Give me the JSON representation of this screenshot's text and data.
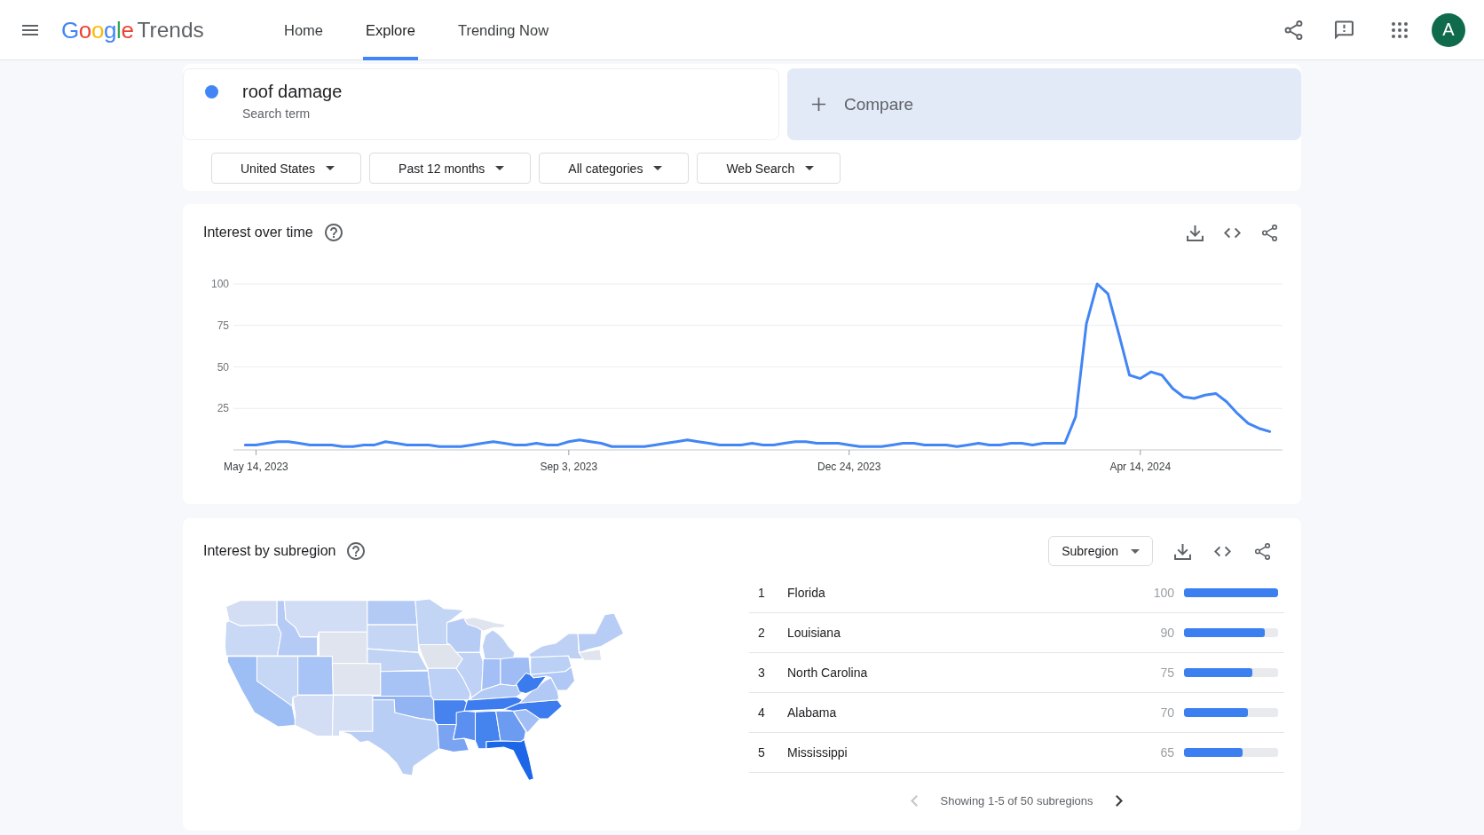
{
  "header": {
    "logo": {
      "brand": "Google",
      "product": "Trends"
    },
    "nav": [
      {
        "label": "Home",
        "selected": false
      },
      {
        "label": "Explore",
        "selected": true
      },
      {
        "label": "Trending Now",
        "selected": false
      }
    ],
    "avatar": "A"
  },
  "search": {
    "terms": [
      {
        "term": "roof damage",
        "subtitle": "Search term",
        "color": "#4285f4"
      }
    ],
    "compare": "Compare",
    "filters": [
      "United States",
      "Past 12 months",
      "All categories",
      "Web Search"
    ]
  },
  "interest_over_time": {
    "title": "Interest over time",
    "chart_data": {
      "type": "line",
      "grid": true,
      "categories": [
        null,
        "May 14, 2023",
        null,
        null,
        null,
        null,
        null,
        null,
        null,
        null,
        null,
        null,
        null,
        null,
        null,
        null,
        null,
        null,
        null,
        null,
        null,
        null,
        null,
        null,
        null,
        null,
        null,
        null,
        null,
        null,
        "Sep 3, 2023",
        null,
        null,
        null,
        null,
        null,
        null,
        null,
        null,
        null,
        null,
        null,
        null,
        null,
        null,
        null,
        null,
        null,
        null,
        null,
        null,
        null,
        null,
        null,
        null,
        null,
        "Dec 24, 2023",
        null,
        null,
        null,
        null,
        null,
        null,
        null,
        null,
        null,
        null,
        null,
        null,
        null,
        null,
        null,
        null,
        null,
        null,
        null,
        null,
        null,
        null,
        null,
        null,
        null,
        null,
        "Apr 14, 2024",
        null,
        null,
        null,
        null,
        null,
        null,
        null,
        null,
        null,
        null,
        null,
        null
      ],
      "ylim": [
        0,
        100
      ],
      "yticks": [
        25,
        50,
        75,
        100
      ],
      "series": [
        {
          "color": "#4285f4",
          "values": [
            3,
            3,
            4,
            5,
            5,
            4,
            3,
            3,
            3,
            2,
            2,
            3,
            3,
            5,
            4,
            3,
            3,
            3,
            2,
            2,
            2,
            3,
            4,
            5,
            4,
            3,
            3,
            4,
            3,
            3,
            5,
            6,
            5,
            4,
            2,
            2,
            2,
            2,
            3,
            4,
            5,
            6,
            5,
            4,
            3,
            3,
            3,
            4,
            3,
            3,
            4,
            5,
            5,
            4,
            4,
            4,
            3,
            2,
            2,
            2,
            3,
            4,
            4,
            3,
            3,
            3,
            2,
            3,
            4,
            3,
            3,
            4,
            4,
            3,
            4,
            4,
            4,
            20,
            76,
            100,
            94,
            70,
            45,
            43,
            47,
            45,
            37,
            32,
            31,
            33,
            34,
            29,
            22,
            16,
            13,
            11
          ]
        }
      ]
    }
  },
  "interest_by_subregion": {
    "title": "Interest by subregion",
    "resolution": "Subregion",
    "rows": [
      {
        "rank": "1",
        "name": "Florida",
        "value": "100",
        "level": 1.0
      },
      {
        "rank": "2",
        "name": "Louisiana",
        "value": "90",
        "level": 0.86
      },
      {
        "rank": "3",
        "name": "North Carolina",
        "value": "75",
        "level": 0.73
      },
      {
        "rank": "4",
        "name": "Alabama",
        "value": "70",
        "level": 0.68
      },
      {
        "rank": "5",
        "name": "Mississippi",
        "value": "65",
        "level": 0.62
      }
    ],
    "pagination": {
      "text": "Showing 1-5 of 50 subregions",
      "previous_disabled": true,
      "next_disabled": false
    }
  }
}
